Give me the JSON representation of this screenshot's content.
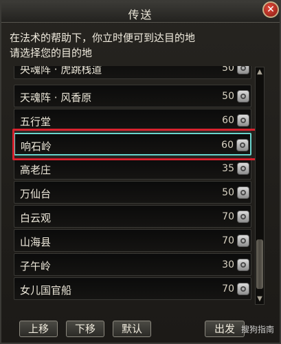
{
  "window": {
    "title": "传送",
    "close_symbol": "✕"
  },
  "description": {
    "line1": "在法术的帮助下，你立时便可到达目的地",
    "line2": "请选择您的目的地"
  },
  "destinations": [
    {
      "name": "央魂阵 · 虎跳栈道",
      "level": "50"
    },
    {
      "name": "天魂阵 · 风香原",
      "level": "50"
    },
    {
      "name": "五行堂",
      "level": "60"
    },
    {
      "name": "响石岭",
      "level": "60",
      "selected": true
    },
    {
      "name": "高老庄",
      "level": "35"
    },
    {
      "name": "万仙台",
      "level": "50"
    },
    {
      "name": "白云观",
      "level": "70"
    },
    {
      "name": "山海县",
      "level": "70"
    },
    {
      "name": "子午岭",
      "level": "30"
    },
    {
      "name": "女儿国官船",
      "level": "70"
    }
  ],
  "scrollbar": {
    "up": "▲",
    "down": "▼"
  },
  "buttons": {
    "move_up": "上移",
    "move_down": "下移",
    "default": "默认",
    "depart": "出发"
  },
  "watermark": "搜狗指南"
}
